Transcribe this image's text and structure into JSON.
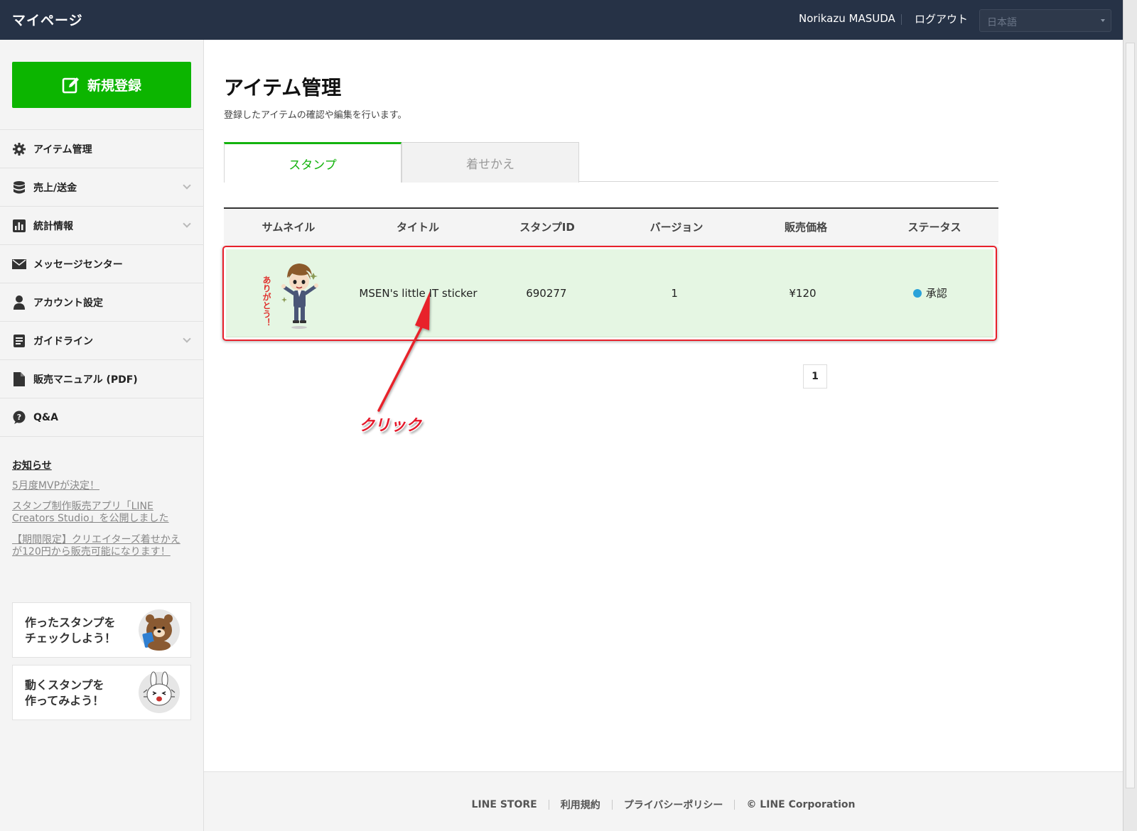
{
  "header": {
    "brand": "マイページ",
    "user_name": "Norikazu MASUDA",
    "logout": "ログアウト",
    "language": "日本語"
  },
  "sidebar": {
    "new_button": "新規登録",
    "items": [
      {
        "label": "アイテム管理",
        "icon": "gear-icon",
        "expandable": false
      },
      {
        "label": "売上/送金",
        "icon": "database-icon",
        "expandable": true
      },
      {
        "label": "統計情報",
        "icon": "bar-chart-icon",
        "expandable": true
      },
      {
        "label": "メッセージセンター",
        "icon": "envelope-icon",
        "expandable": false
      },
      {
        "label": "アカウント設定",
        "icon": "user-icon",
        "expandable": false
      },
      {
        "label": "ガイドライン",
        "icon": "document-icon",
        "expandable": true
      },
      {
        "label": "販売マニュアル (PDF)",
        "icon": "file-icon",
        "expandable": false
      },
      {
        "label": "Q&A",
        "icon": "question-bubble-icon",
        "expandable": false
      }
    ],
    "news_heading": "お知らせ",
    "news": [
      "5月度MVPが決定！",
      "スタンプ制作販売アプリ「LINE Creators Studio」を公開しました",
      "【期間限定】クリエイターズ着せかえが120円から販売可能になります！"
    ],
    "promos": [
      {
        "text": "作ったスタンプを\nチェックしよう！",
        "icon": "brown-bear-icon"
      },
      {
        "text": "動くスタンプを\n作ってみよう！",
        "icon": "cony-rabbit-icon"
      }
    ]
  },
  "main": {
    "title": "アイテム管理",
    "subtitle": "登録したアイテムの確認や編集を行います。",
    "tabs": [
      {
        "label": "スタンプ",
        "active": true
      },
      {
        "label": "着せかえ",
        "active": false
      }
    ],
    "table": {
      "columns": [
        "サムネイル",
        "タイトル",
        "スタンプID",
        "バージョン",
        "販売価格",
        "ステータス"
      ],
      "rows": [
        {
          "thumbnail": "sticker-thumbnail",
          "thumbnail_caption": "ありがとう！",
          "title": "MSEN's little IT sticker",
          "id": "690277",
          "version": "1",
          "price": "¥120",
          "status": "承認",
          "status_color": "#2aa2d9"
        }
      ]
    },
    "pagination": {
      "current": "1"
    },
    "annotation": {
      "label": "クリック",
      "color": "#e5182a"
    }
  },
  "footer": {
    "links": [
      "LINE STORE",
      "利用規約",
      "プライバシーポリシー",
      "© LINE Corporation"
    ]
  },
  "colors": {
    "header_bg": "#263246",
    "accent_green": "#0cb500",
    "row_highlight": "#e5f6e3"
  }
}
